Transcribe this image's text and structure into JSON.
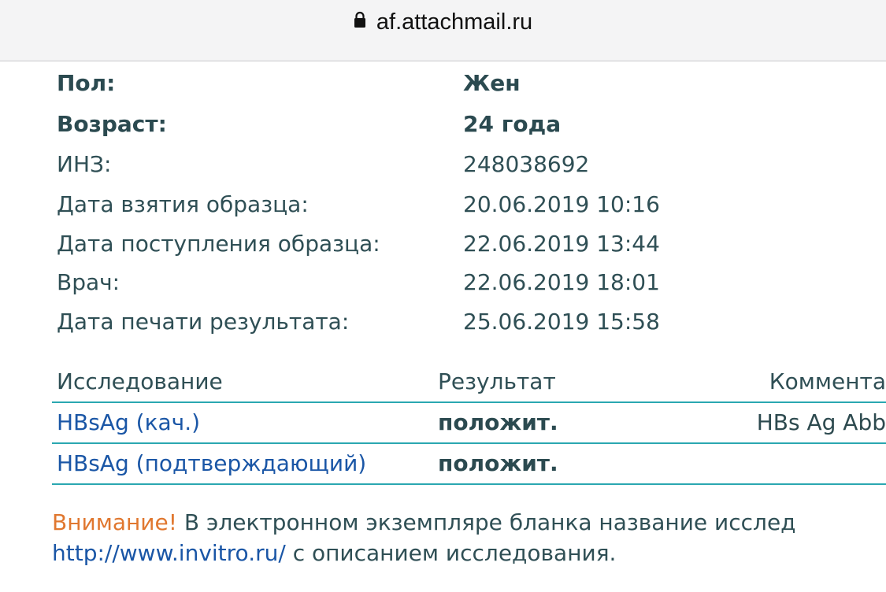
{
  "browser": {
    "url": "af.attachmail.ru",
    "lock_icon": "lock-icon"
  },
  "patient": [
    {
      "label": "Пол:",
      "value": "Жен",
      "bold": true
    },
    {
      "label": "Возраст:",
      "value": "24 года",
      "bold": true
    },
    {
      "label": "ИНЗ:",
      "value": "248038692",
      "bold": false
    },
    {
      "label": "Дата взятия образца:",
      "value": "20.06.2019 10:16",
      "bold": false
    },
    {
      "label": "Дата поступления образца:",
      "value": "22.06.2019 13:44",
      "bold": false
    },
    {
      "label": "Врач:",
      "value": "22.06.2019 18:01",
      "bold": false
    },
    {
      "label": "Дата печати результата:",
      "value": "25.06.2019 15:58",
      "bold": false
    }
  ],
  "results_table": {
    "headers": [
      "Исследование",
      "Результат",
      "Коммента"
    ],
    "rows": [
      {
        "test": "HBsAg (кач.)",
        "result": "положит.",
        "comment": "HBs Ag Abb"
      },
      {
        "test": "HBsAg (подтверждающий)",
        "result": "положит.",
        "comment": ""
      }
    ]
  },
  "notice": {
    "warning_word": "Внимание!",
    "text_line1": " В электронном экземпляре бланка название исслед",
    "link": "http://www.invitro.ru/",
    "text_line2": " с описанием исследования."
  },
  "colors": {
    "accent_line": "#2aa7b1",
    "link": "#1a56a6",
    "warning": "#e0772f",
    "text": "#2f4f55"
  }
}
